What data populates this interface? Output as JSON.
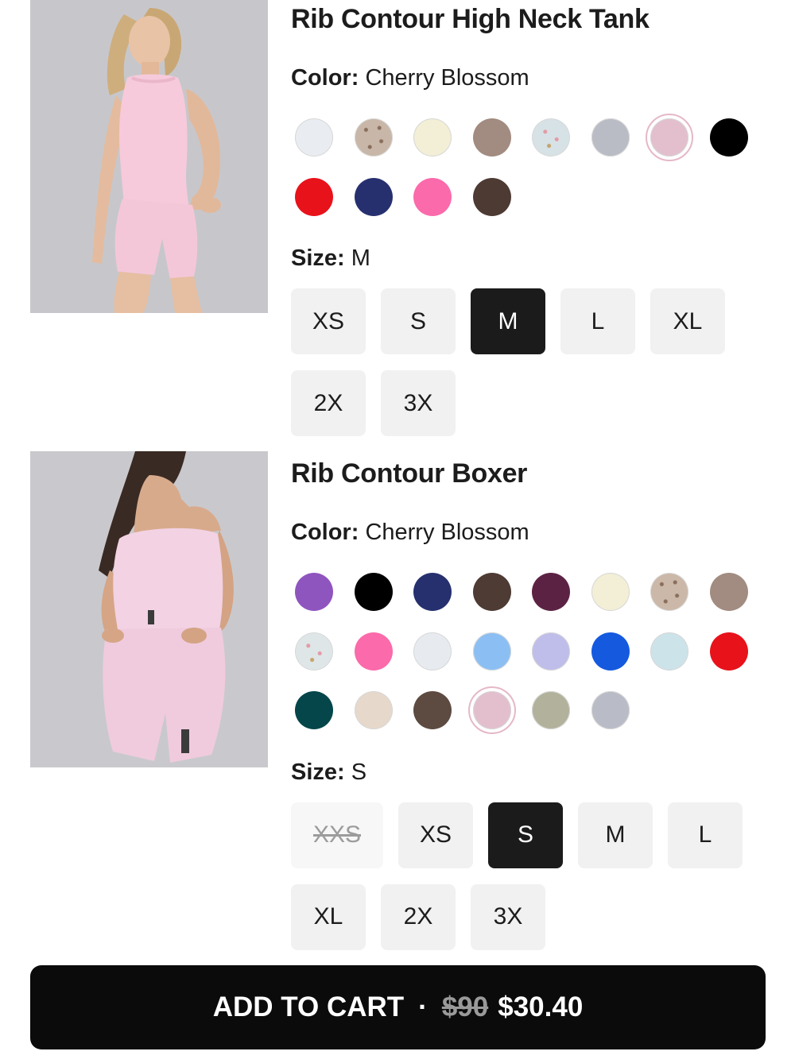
{
  "products": [
    {
      "title": "Rib Contour High Neck Tank",
      "color_label": "Color:",
      "color_value": "Cherry Blossom",
      "size_label": "Size:",
      "size_value": "M",
      "swatches": [
        {
          "name": "white",
          "color": "#e9edf1"
        },
        {
          "name": "leopard",
          "color": "#c8b7a8"
        },
        {
          "name": "cream",
          "color": "#f3efd6"
        },
        {
          "name": "mocha",
          "color": "#a28b80"
        },
        {
          "name": "floral-print",
          "color": "#d7e2e6"
        },
        {
          "name": "grey",
          "color": "#b9bcc4"
        },
        {
          "name": "cherry-blossom",
          "color": "#e3bfce"
        },
        {
          "name": "black",
          "color": "#000000"
        },
        {
          "name": "red",
          "color": "#e8121b"
        },
        {
          "name": "navy",
          "color": "#27306f"
        },
        {
          "name": "hot-pink",
          "color": "#fb6aab"
        },
        {
          "name": "chocolate",
          "color": "#4c3a33"
        }
      ],
      "sizes": [
        "XS",
        "S",
        "M",
        "L",
        "XL",
        "2X",
        "3X"
      ]
    },
    {
      "title": "Rib Contour Boxer",
      "color_label": "Color:",
      "color_value": "Cherry Blossom",
      "size_label": "Size:",
      "size_value": "S",
      "swatches": [
        {
          "name": "purple",
          "color": "#8f55bf"
        },
        {
          "name": "black",
          "color": "#000000"
        },
        {
          "name": "navy",
          "color": "#26306e"
        },
        {
          "name": "chocolate",
          "color": "#4d3b34"
        },
        {
          "name": "plum",
          "color": "#5c2244"
        },
        {
          "name": "cream",
          "color": "#f3efd6"
        },
        {
          "name": "leopard",
          "color": "#cbb8a8"
        },
        {
          "name": "mocha",
          "color": "#a28b80"
        },
        {
          "name": "floral-print",
          "color": "#dfe6e8"
        },
        {
          "name": "hot-pink",
          "color": "#fb6aab"
        },
        {
          "name": "white",
          "color": "#e7ebf0"
        },
        {
          "name": "sky-blue",
          "color": "#8bbff4"
        },
        {
          "name": "lavender",
          "color": "#bfbdea"
        },
        {
          "name": "royal-blue",
          "color": "#1559df"
        },
        {
          "name": "pale-blue",
          "color": "#cde3ea"
        },
        {
          "name": "red",
          "color": "#e8121b"
        },
        {
          "name": "forest-green",
          "color": "#04464a"
        },
        {
          "name": "sand",
          "color": "#e6d9cb"
        },
        {
          "name": "brown",
          "color": "#5d4a41"
        },
        {
          "name": "cherry-blossom",
          "color": "#e3bfce"
        },
        {
          "name": "sage",
          "color": "#b2b29c"
        },
        {
          "name": "grey",
          "color": "#b9bcc6"
        }
      ],
      "sizes": [
        "XXS",
        "XS",
        "S",
        "M",
        "L",
        "XL",
        "2X",
        "3X"
      ]
    }
  ],
  "cart": {
    "label": "ADD TO CART",
    "separator": "·",
    "old_price": "$90",
    "price": "$30.40"
  }
}
